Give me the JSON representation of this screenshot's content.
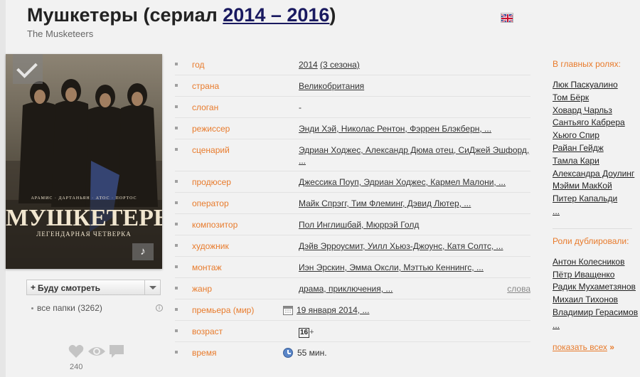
{
  "header": {
    "title_prefix": "Мушкетеры (сериал ",
    "title_years": "2014 – 2016",
    "title_suffix": ")",
    "original_title": "The Musketeers"
  },
  "poster": {
    "cast_line": "АРАМИС · ДАРТАНЬЯН · АТОС · ПОРТОС",
    "title": "МУШКЕТЕРЫ",
    "subtitle": "ЛЕГЕНДАРНАЯ ЧЕТВЕРКА"
  },
  "watch": {
    "plus": "+",
    "label": "Буду смотреть",
    "folders": "все папки (3262)"
  },
  "social": {
    "likes": "240"
  },
  "info": {
    "rows": [
      {
        "label": "год",
        "value": "2014",
        "extra": "(3 сезона)"
      },
      {
        "label": "страна",
        "value": "Великобритания"
      },
      {
        "label": "слоган",
        "value": "-"
      },
      {
        "label": "режиссер",
        "value": "Энди Хэй, Николас Рентон, Фэррен Блэкберн, ..."
      },
      {
        "label": "сценарий",
        "value": "Эдриан Ходжес, Александр Дюма отец, СиДжей Эшфорд, ..."
      },
      {
        "label": "продюсер",
        "value": "Джессика Поуп, Эдриан Ходжес, Кармел Малони, ..."
      },
      {
        "label": "оператор",
        "value": "Майк Спрэгг, Тим Флеминг, Дэвид Лютер, ..."
      },
      {
        "label": "композитор",
        "value": "Пол Инглишбай, Мюррэй Голд"
      },
      {
        "label": "художник",
        "value": "Дэйв Эрроусмит, Уилл Хьюз-Джоунс, Катя Солтс, ..."
      },
      {
        "label": "монтаж",
        "value": "Иэн Эрскин, Эмма Оксли, Мэттью Кеннингс, ..."
      },
      {
        "label": "жанр",
        "value": "драма, приключения, ...",
        "extra": "слова"
      },
      {
        "label": "премьера (мир)",
        "value": "19 января 2014, ..."
      },
      {
        "label": "возраст",
        "value": "16",
        "extra": "+"
      },
      {
        "label": "время",
        "value": "55 мин."
      }
    ]
  },
  "cast": {
    "heading": "В главных ролях:",
    "actors": [
      "Люк Паскуалино",
      "Том Бёрк",
      "Ховард Чарльз",
      "Сантьяго Кабрера",
      "Хьюго Спир",
      "Райан Гейдж",
      "Тамла Кари",
      "Александра Доулинг",
      "Мэйми МакКой",
      "Питер Капальди",
      "..."
    ],
    "dub_heading": "Роли дублировали:",
    "dubbers": [
      "Антон Колесников",
      "Пётр Иващенко",
      "Радик Мухаметзянов",
      "Михаил Тихонов",
      "Владимир Герасимов",
      "..."
    ],
    "show_all": "показать всех",
    "show_all_arrow": "»"
  },
  "colors": {
    "label": "#e87b2c",
    "title_link": "#1a1a60",
    "background": "#f2f2f2"
  }
}
